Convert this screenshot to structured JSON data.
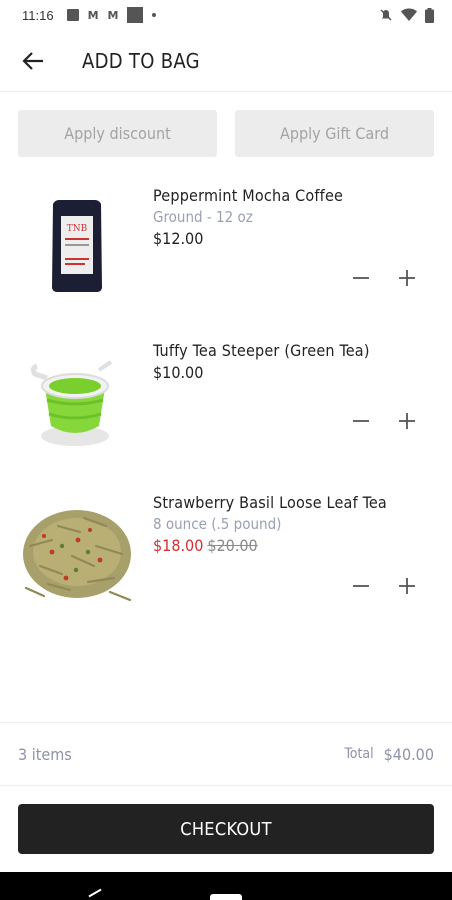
{
  "status_bar": {
    "time": "11:16"
  },
  "header": {
    "title": "ADD TO BAG"
  },
  "promo": {
    "discount_label": "Apply discount",
    "gift_card_label": "Apply Gift Card"
  },
  "items": [
    {
      "name": "Peppermint Mocha Coffee",
      "variant": "Ground - 12 oz",
      "price": "$12.00"
    },
    {
      "name": "Tuffy Tea Steeper (Green Tea)",
      "price": "$10.00"
    },
    {
      "name": "Strawberry Basil Loose Leaf Tea",
      "variant": "8 ounce (.5 pound)",
      "sale_price": "$18.00",
      "original_price": "$20.00"
    }
  ],
  "summary": {
    "item_count": "3 items",
    "total_label": "Total",
    "total_value": "$40.00"
  },
  "checkout": {
    "label": "CHECKOUT"
  },
  "colors": {
    "accent_dark": "#222222",
    "sale_red": "#d32f2f",
    "muted_text": "#9aa0b4",
    "button_bg": "#ececec"
  }
}
